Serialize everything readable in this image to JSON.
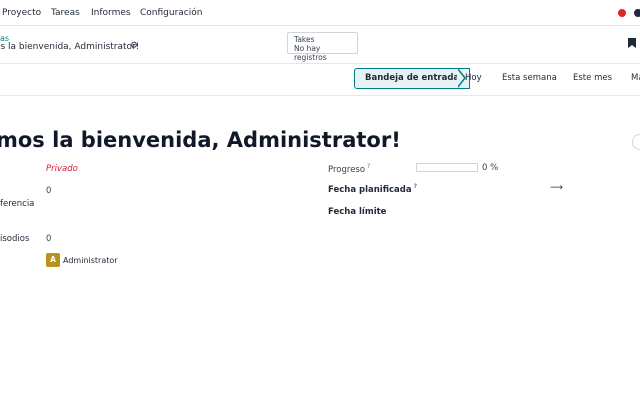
{
  "topnav": {
    "items": [
      "Proyecto",
      "Tareas",
      "Informes",
      "Configuración"
    ],
    "status_dot_color": "#dc2626"
  },
  "control_panel": {
    "breadcrumb_parent": "as",
    "record_title": "os la bienvenida, Administrator!",
    "takes": {
      "title": "Takes",
      "value": "No hay registros"
    }
  },
  "statusbar": {
    "stages": [
      "Bandeja de entrada",
      "Hoy",
      "Esta semana",
      "Este mes",
      "Ma"
    ],
    "active_stage": "Bandeja de entrada",
    "accent_color": "#017e84"
  },
  "form": {
    "title": "mos la bienvenida, Administrator!",
    "left_fields": [
      {
        "label": "",
        "value": "Privado"
      },
      {
        "label": "ferencia",
        "value": "0"
      },
      {
        "label": "isodios",
        "value": "0"
      },
      {
        "label": "",
        "value": "Administrator",
        "avatar_letter": "A"
      }
    ],
    "right_fields": {
      "progress_label": "Progreso",
      "progress_value": "0 %",
      "progress_fraction": 0,
      "planned_date_label": "Fecha planificada",
      "deadline_label": "Fecha límite"
    }
  }
}
